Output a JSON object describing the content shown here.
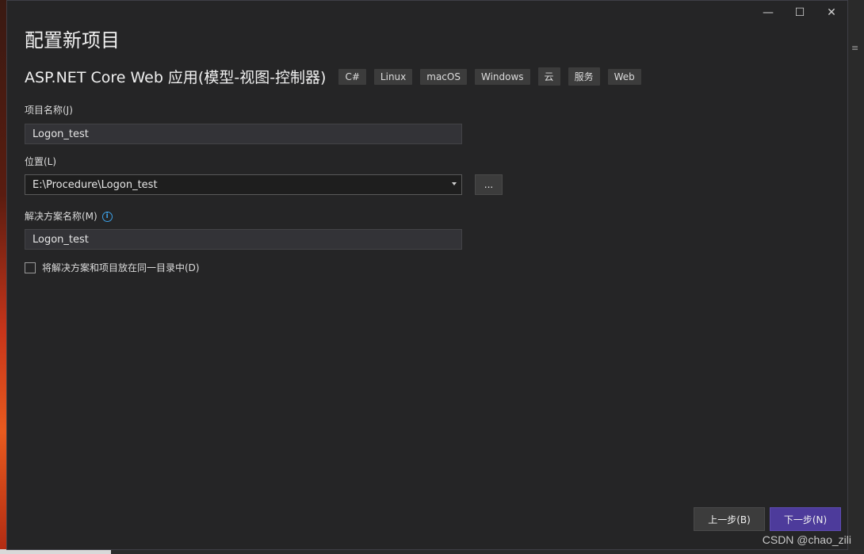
{
  "window": {
    "title": "配置新项目",
    "controls": {
      "minimize": "—",
      "maximize": "☐",
      "close": "✕"
    }
  },
  "template": {
    "name": "ASP.NET Core Web 应用(模型-视图-控制器)",
    "tags": [
      "C#",
      "Linux",
      "macOS",
      "Windows",
      "云",
      "服务",
      "Web"
    ]
  },
  "project_name": {
    "label": "项目名称(J)",
    "value": "Logon_test"
  },
  "location": {
    "label": "位置(L)",
    "value": "E:\\Procedure\\Logon_test",
    "browse_label": "..."
  },
  "solution_name": {
    "label": "解决方案名称(M)",
    "value": "Logon_test",
    "info_glyph": "i"
  },
  "same_dir": {
    "label": "将解决方案和项目放在同一目录中(D)",
    "checked": false
  },
  "buttons": {
    "back": "上一步(B)",
    "next": "下一步(N)"
  },
  "watermark": "CSDN @chao_zili",
  "colors": {
    "dialog_bg": "#252526",
    "next_button": "#4d3b9b",
    "info_icon": "#3ca0e6"
  }
}
